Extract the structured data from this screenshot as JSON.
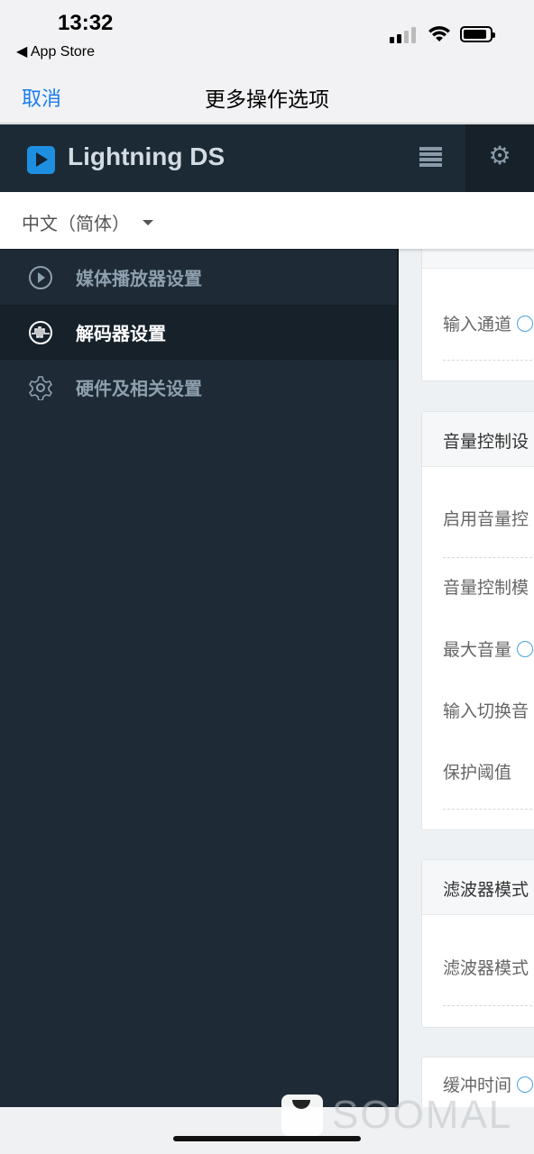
{
  "status_bar": {
    "time": "13:32",
    "back_app": "◀ App Store"
  },
  "nav": {
    "cancel": "取消",
    "title": "更多操作选项"
  },
  "header": {
    "brand": "Lightning DS",
    "menu_icon": "list-icon",
    "settings_icon": "gear-icon",
    "accent": "#1e8fe0"
  },
  "language": {
    "selected": "中文（简体）"
  },
  "sidebar": {
    "items": [
      {
        "label": "媒体播放器设置",
        "icon": "play-circle-icon",
        "active": false
      },
      {
        "label": "解码器设置",
        "icon": "waveform-icon",
        "active": true
      },
      {
        "label": "硬件及相关设置",
        "icon": "gear-icon",
        "active": false
      }
    ]
  },
  "content": {
    "card1": {
      "row": "输入通道"
    },
    "card2": {
      "header": "音量控制设",
      "rows": [
        "启用音量控",
        "音量控制模",
        "最大音量",
        "输入切换音",
        "保护阈值"
      ]
    },
    "card3": {
      "header": "滤波器模式",
      "row": "滤波器模式"
    },
    "card4": {
      "row": "缓冲时间"
    }
  },
  "watermark": "SOOMAL"
}
